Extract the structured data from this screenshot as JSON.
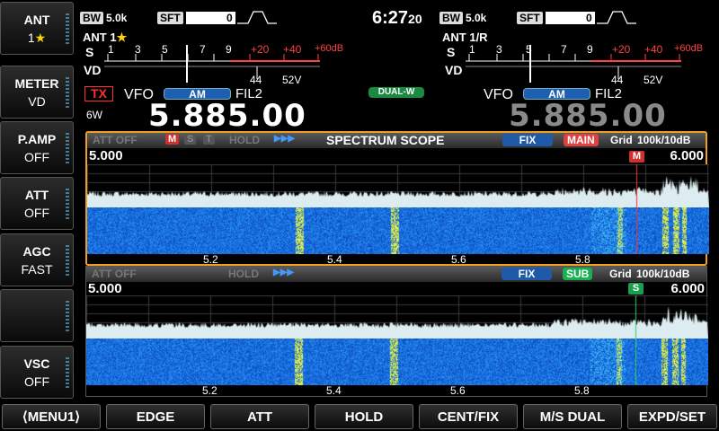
{
  "side_buttons": [
    {
      "title": "ANT",
      "value": "1",
      "star": "★"
    },
    {
      "title": "METER",
      "value": "VD"
    },
    {
      "title": "P.AMP",
      "value": "OFF"
    },
    {
      "title": "ATT",
      "value": "OFF"
    },
    {
      "title": "AGC",
      "value": "FAST"
    },
    {
      "title": "",
      "value": ""
    },
    {
      "title": "VSC",
      "value": "OFF"
    }
  ],
  "bottom_buttons": [
    "⟨MENU1⟩",
    "EDGE",
    "ATT",
    "HOLD",
    "CENT/FIX",
    "M/S  DUAL",
    "EXPD/SET"
  ],
  "main": {
    "bw_label": "BW",
    "bw_value": "5.0k",
    "sft_label": "SFT",
    "sft_value": "0",
    "ant": "ANT",
    "ant_num": "1",
    "ant_star": "★",
    "meter_s": "S",
    "meter_vd": "VD",
    "s_ticks": [
      "1",
      "3",
      "5",
      "7",
      "9",
      "+20",
      "+40",
      "+60dB"
    ],
    "vd_ticks": [
      "44",
      "52V"
    ],
    "tx": "TX",
    "power": "6W",
    "vfo": "VFO",
    "mode": "AM",
    "filter": "FIL2",
    "frequency": "5.885.00"
  },
  "sub": {
    "bw_label": "BW",
    "bw_value": "5.0k",
    "sft_label": "SFT",
    "sft_value": "0",
    "ant": "ANT",
    "ant_num": "1/R",
    "meter_s": "S",
    "meter_vd": "VD",
    "s_ticks": [
      "1",
      "3",
      "5",
      "7",
      "9",
      "+20",
      "+40",
      "+60dB"
    ],
    "vd_ticks": [
      "44",
      "52V"
    ],
    "vfo": "VFO",
    "mode": "AM",
    "filter": "FIL2",
    "frequency": "5.885.00"
  },
  "clock": {
    "time": "6:27",
    "seconds": "20"
  },
  "dual_watch": "DUAL-W",
  "scope_main": {
    "att": "ATT OFF",
    "m": "M",
    "s": "S",
    "t": "T",
    "hold": "HOLD",
    "arrows": "▶▶▶",
    "title": "SPECTRUM  SCOPE",
    "fix": "FIX",
    "band": "MAIN",
    "grid": "Grid",
    "span": "100k/10dB",
    "left_edge": "5.000",
    "right_edge": "6.000",
    "marker": "M",
    "freq_ticks": [
      "5.2",
      "5.4",
      "5.6",
      "5.8"
    ]
  },
  "scope_sub": {
    "att": "ATT OFF",
    "hold": "HOLD",
    "arrows": "▶▶▶",
    "fix": "FIX",
    "band": "SUB",
    "grid": "Grid",
    "span": "100k/10dB",
    "left_edge": "5.000",
    "right_edge": "6.000",
    "marker": "S",
    "freq_ticks": [
      "5.2",
      "5.4",
      "5.6",
      "5.8"
    ]
  },
  "colors": {
    "accent_orange": "#f0a020",
    "main_red": "#e04040",
    "sub_green": "#18b050",
    "fix_blue": "#1f5aa8",
    "spectrum_fill": "#dcecf0",
    "waterfall_bg": "#1a5cd8"
  }
}
